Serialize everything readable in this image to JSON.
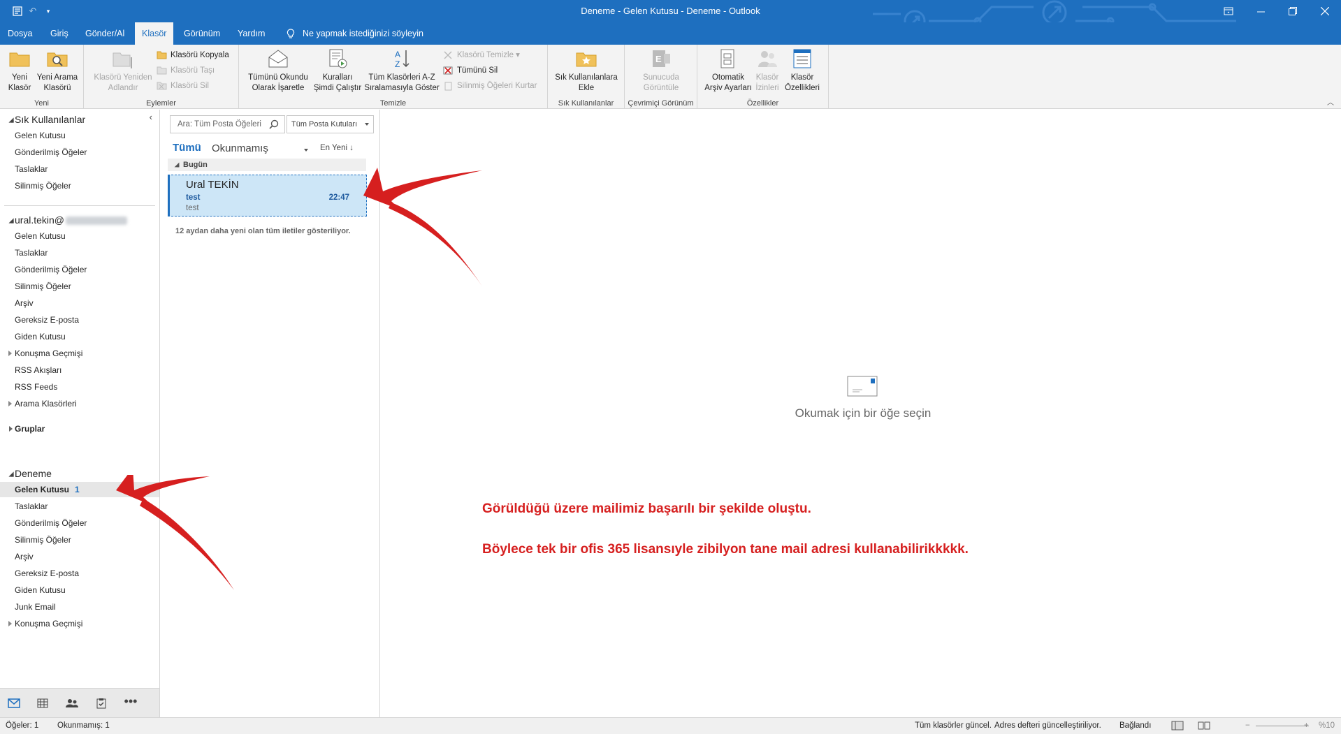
{
  "window": {
    "title": "Deneme - Gelen Kutusu - Deneme  -  Outlook",
    "minimize_icon": "minimize-icon",
    "restore_icon": "restore-icon",
    "close_icon": "close-icon"
  },
  "tabs": [
    {
      "label": "Dosya"
    },
    {
      "label": "Giriş"
    },
    {
      "label": "Gönder/Al"
    },
    {
      "label": "Klasör"
    },
    {
      "label": "Görünüm"
    },
    {
      "label": "Yardım"
    }
  ],
  "tell_me": "Ne yapmak istediğinizi söyleyin",
  "ribbon": {
    "groups": {
      "yeni": "Yeni",
      "eylemler": "Eylemler",
      "temizle": "Temizle",
      "sik": "Sık Kullanılanlar",
      "cevrimici": "Çevrimiçi Görünüm",
      "ozellikler": "Özellikler"
    },
    "yeni_klasor": [
      "Yeni",
      "Klasör"
    ],
    "yeni_arama": [
      "Yeni Arama",
      "Klasörü"
    ],
    "yeniden_adlandir": [
      "Klasörü Yeniden",
      "Adlandır"
    ],
    "kopyala": "Klasörü Kopyala",
    "tasi": "Klasörü Taşı",
    "sil": "Klasörü Sil",
    "okundu": [
      "Tümünü Okundu",
      "Olarak İşaretle"
    ],
    "kurallar": [
      "Kuralları",
      "Şimdi Çalıştır"
    ],
    "az": [
      "Tüm Klasörleri A-Z",
      "Sıralamasıyla Göster"
    ],
    "temizle_btn": "Klasörü Temizle",
    "tumunu_sil": "Tümünü Sil",
    "kurtar": "Silinmiş Öğeleri Kurtar",
    "sik_ekle": [
      "Sık Kullanılanlara",
      "Ekle"
    ],
    "sunucu": [
      "Sunucuda",
      "Görüntüle"
    ],
    "arsiv": [
      "Otomatik",
      "Arşiv Ayarları"
    ],
    "izinler": [
      "Klasör",
      "İzinleri"
    ],
    "ozellik": [
      "Klasör",
      "Özellikleri"
    ]
  },
  "folders": {
    "favorites_title": "Sık Kullanılanlar",
    "favorites": [
      "Gelen Kutusu",
      "Gönderilmiş Öğeler",
      "Taslaklar",
      "Silinmiş Öğeler"
    ],
    "account_title": "ural.tekin@",
    "account_items": [
      "Gelen Kutusu",
      "Taslaklar",
      "Gönderilmiş Öğeler",
      "Silinmiş Öğeler",
      "Arşiv",
      "Gereksiz E-posta",
      "Giden Kutusu",
      "Konuşma Geçmişi",
      "RSS Akışları",
      "RSS Feeds",
      "Arama Klasörleri"
    ],
    "groups": "Gruplar",
    "deneme_title": "Deneme",
    "deneme_inbox": "Gelen Kutusu",
    "deneme_inbox_count": "1",
    "deneme_items": [
      "Taslaklar",
      "Gönderilmiş Öğeler",
      "Silinmiş Öğeler",
      "Arşiv",
      "Gereksiz E-posta",
      "Giden Kutusu",
      "Junk Email",
      "Konuşma Geçmişi"
    ]
  },
  "messages": {
    "search_placeholder": "Ara: Tüm Posta Öğeleri",
    "scope": "Tüm Posta Kutuları",
    "filter_all": "Tümü",
    "filter_unread": "Okunmamış",
    "sort": "En Yeni ↓",
    "group_today": "Bugün",
    "items": [
      {
        "from": "Ural TEKİN",
        "subject": "test",
        "time": "22:47",
        "preview": "test"
      }
    ],
    "older_note": "12 aydan daha yeni olan tüm iletiler gösteriliyor."
  },
  "reading": {
    "empty_text": "Okumak için bir öğe seçin",
    "annotation_1": "Görüldüğü üzere mailimiz başarılı bir şekilde oluştu.",
    "annotation_2": "Böylece tek bir ofis 365 lisansıyle zibilyon tane mail adresi kullanabilirikkkkk."
  },
  "status": {
    "items": "Öğeler: 1",
    "unread": "Okunmamış: 1",
    "folders_state": "Tüm klasörler güncel.",
    "addressbook_state": "Adres defteri güncelleştiriliyor.",
    "connection": "Bağlandı",
    "zoom": "%10"
  },
  "colors": {
    "brand": "#1e6fbf",
    "annotation": "#d61f1f",
    "selection": "#cde6f7"
  }
}
